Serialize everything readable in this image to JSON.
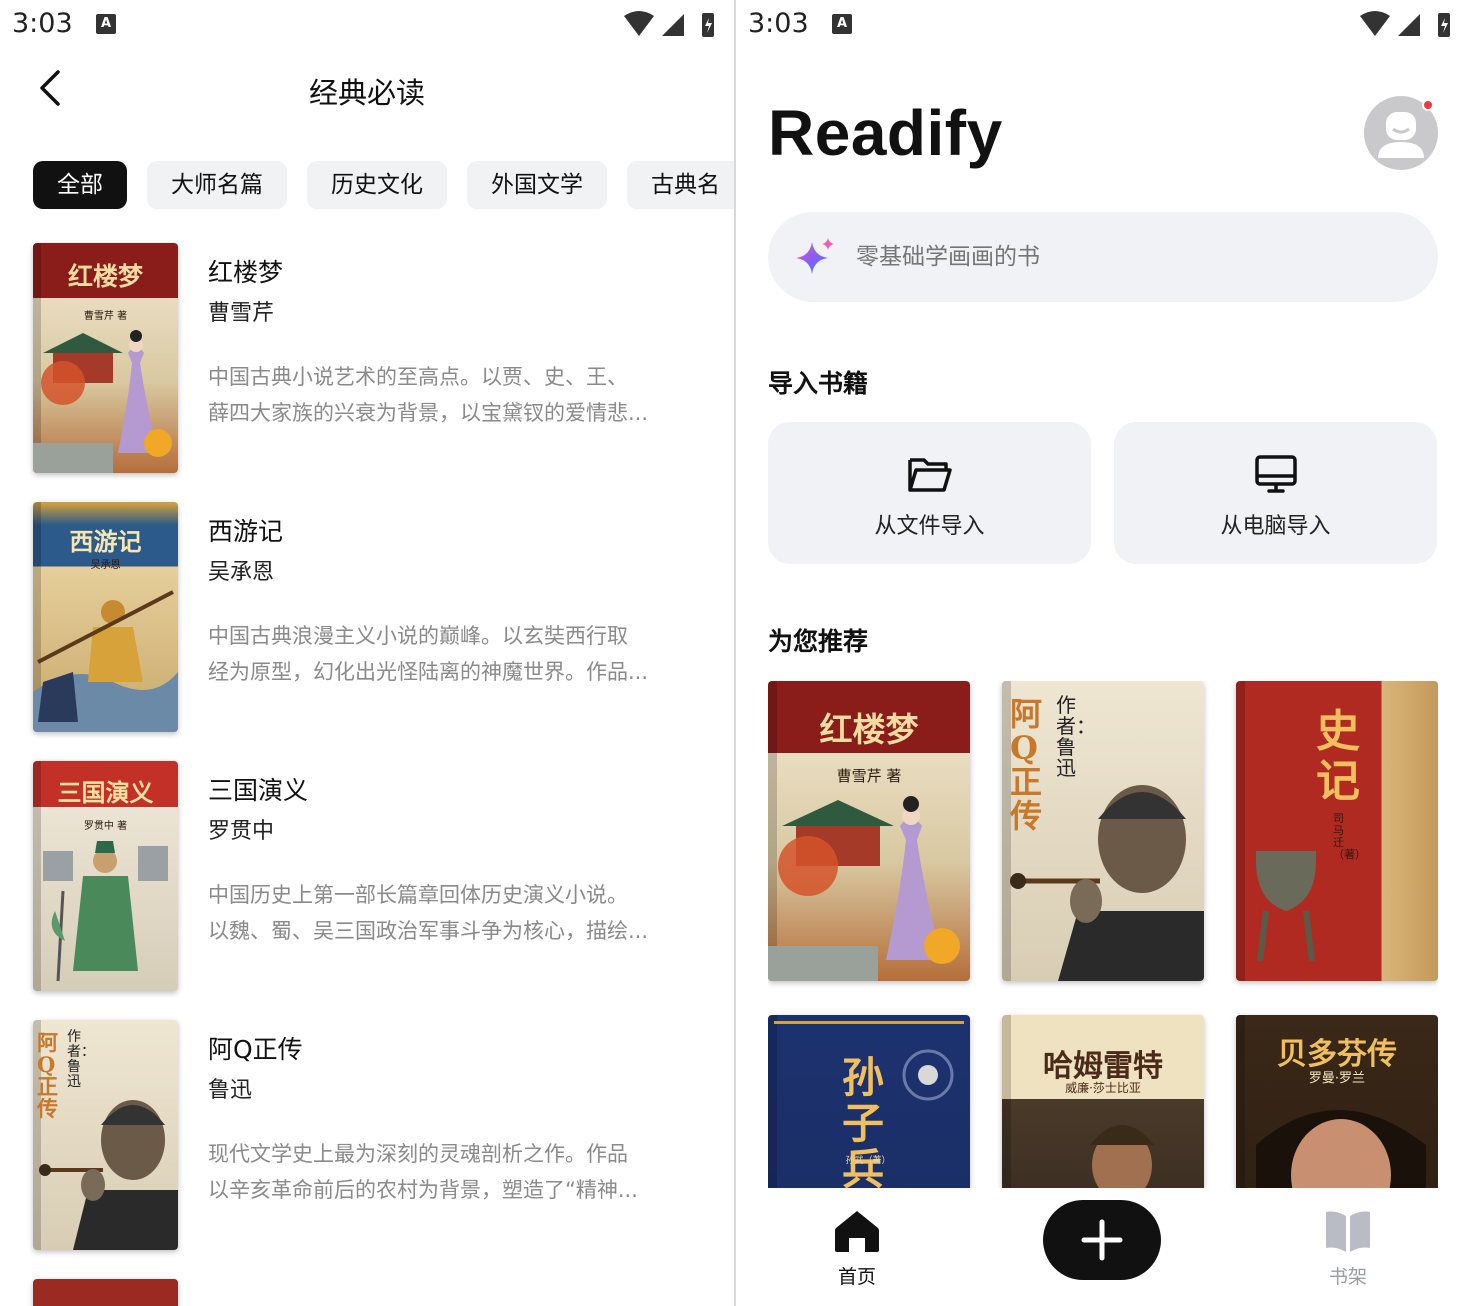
{
  "left_screen": {
    "status": {
      "time": "3:03",
      "badge": "A"
    },
    "title": "经典必读",
    "chips": [
      "全部",
      "大师名篇",
      "历史文化",
      "外国文学",
      "古典名"
    ],
    "books": [
      {
        "name": "红楼梦",
        "author": "曹雪芹",
        "desc1": "中国古典小说艺术的至高点。以贾、史、王、",
        "desc2": "薛四大家族的兴衰为背景，以宝黛钗的爱情悲...",
        "cover_title": "红楼梦",
        "cover_author": "曹雪芹 著"
      },
      {
        "name": "西游记",
        "author": "吴承恩",
        "desc1": "中国古典浪漫主义小说的巅峰。以玄奘西行取",
        "desc2": "经为原型，幻化出光怪陆离的神魔世界。作品...",
        "cover_title": "西游记",
        "cover_author": "吴承恩"
      },
      {
        "name": "三国演义",
        "author": "罗贯中",
        "desc1": "中国历史上第一部长篇章回体历史演义小说。",
        "desc2": "以魏、蜀、吴三国政治军事斗争为核心，描绘...",
        "cover_title": "三国演义",
        "cover_author": "罗贯中 著"
      },
      {
        "name": "阿Q正传",
        "author": "鲁迅",
        "desc1": "现代文学史上最为深刻的灵魂剖析之作。作品",
        "desc2": "以辛亥革命前后的农村为背景，塑造了“精神...",
        "cover_title": "阿Q正传",
        "cover_author": "作者：鲁迅"
      }
    ]
  },
  "right_screen": {
    "status": {
      "time": "3:03",
      "badge": "A"
    },
    "brand": "Readify",
    "search_placeholder": "零基础学画画的书",
    "import_section": "导入书籍",
    "import_file": "从文件导入",
    "import_pc": "从电脑导入",
    "recommend_section": "为您推荐",
    "recommendations": [
      {
        "title": "红楼梦",
        "sub": "曹雪芹 著"
      },
      {
        "title": "阿Q正传",
        "sub": "作者：鲁迅"
      },
      {
        "title": "史记",
        "sub": "司马迁（著）"
      },
      {
        "title": "孙子兵",
        "sub": "孙武（著）"
      },
      {
        "title": "哈姆雷特",
        "sub": "威廉·莎士比亚"
      },
      {
        "title": "贝多芬传",
        "sub": "罗曼·罗兰"
      }
    ],
    "nav": {
      "home": "首页",
      "shelf": "书架"
    }
  },
  "colors": {
    "accent": "#111111",
    "chip_bg": "#f1f2f4",
    "muted_text": "#8a8a8a",
    "notification": "#ef3b3b"
  }
}
